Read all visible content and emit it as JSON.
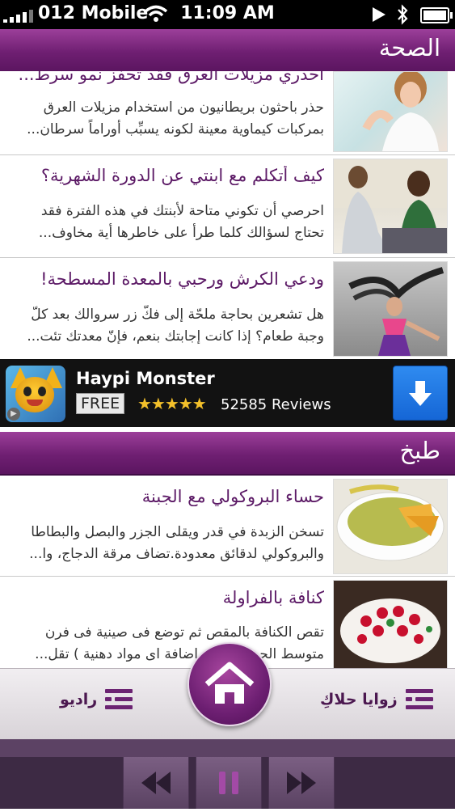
{
  "status_bar": {
    "carrier": "012 Mobile",
    "time": "11:09 AM"
  },
  "sections": [
    {
      "title": "الصحة"
    },
    {
      "title": "طبخ"
    }
  ],
  "articles": [
    {
      "title": "احذري مزيلات العرق فقد تحفّز نمو سرط...",
      "lines": [
        "حذر باحثون بريطانيون من استخدام مزيلات العرق",
        "بمركبات كيماوية معينة لكونه يسبِّب أوراماً سرطان..."
      ]
    },
    {
      "title": "كيف أتكلم مع ابنتي عن الدورة الشهرية؟",
      "lines": [
        "احرصي أن تكوني متاحة لأبنتك في هذه الفترة فقد",
        "تحتاج لسؤالك كلما طرأ على خاطرها أية مخاوف..."
      ]
    },
    {
      "title": "ودعي الكرش ورحبي بالمعدة المسطحة!",
      "lines": [
        "هل تشعرين بحاجة ملحّة إلى فكّ زر سروالك بعد كلّ",
        "وجبة طعام؟ إذا كانت إجابتك بنعم، فإنّ معدتك تئت..."
      ]
    },
    {
      "title": "حساء البروكولي مع الجبنة",
      "lines": [
        "تسخن الزبدة في قدر ويقلى الجزر والبصل والبطاطا",
        "والبروكولي لدقائق معدودة.تضاف مرقة الدجاج، وا..."
      ]
    },
    {
      "title": "كنافة بالفراولة",
      "lines": [
        "تقص الكنافة بالمقص ثم توضع فى صينية فى فرن",
        "متوسط الحرارة بدون اضافة اى مواد دهنية ) تقل..."
      ]
    }
  ],
  "ad": {
    "app_name": "Haypi Monster",
    "price": "FREE",
    "stars": "★★★★★",
    "rating": 4.5,
    "reviews": "52585 Reviews"
  },
  "tabbar": {
    "left_label": "راديو",
    "right_label": "زوايا حلاكِ"
  },
  "icons": {
    "home": "home-icon",
    "list": "list-icon",
    "download": "download-arrow-icon",
    "rewind": "rewind-icon",
    "pause": "pause-icon",
    "forward": "fast-forward-icon"
  },
  "colors": {
    "brand_purple": "#6f1f72",
    "accent_blue": "#1f74e0"
  }
}
